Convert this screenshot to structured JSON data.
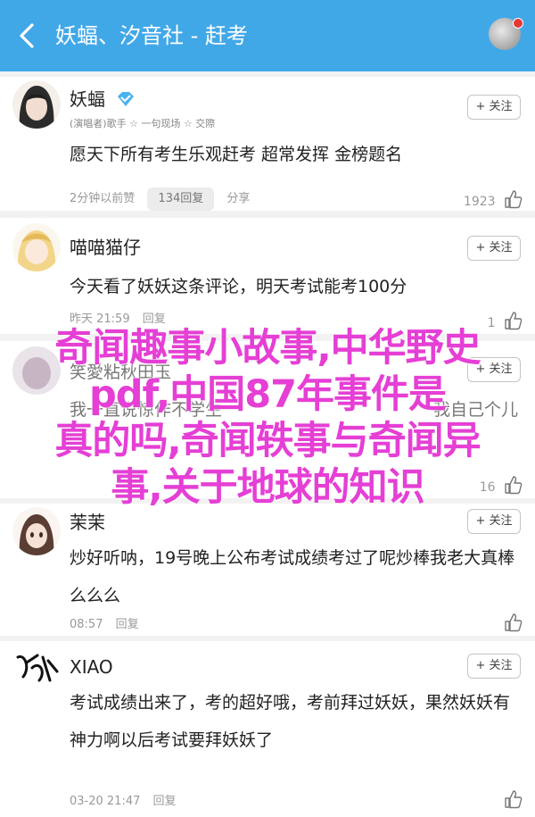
{
  "header": {
    "title": "妖蝠、汐音社 - 赶考",
    "back_icon": "back-arrow-icon",
    "bg_color": "#41a8e8"
  },
  "comments": [
    {
      "name": "妖蝠",
      "badge": "(演唱者)歌手  ☆ 一句现场  ☆ 交際",
      "follow": "+ 关注",
      "text": "愿天下所有考生乐观赶考 超常发挥 金榜题名",
      "time": "2分钟以前赞",
      "reply_count": "134回复",
      "share": "分享",
      "likes": "1923"
    },
    {
      "name": "喵喵猫仔",
      "follow": "+ 关注",
      "text": "今天看了妖妖这条评论，明天考试能考100分",
      "time": "昨天 21:59",
      "reply": "回复",
      "likes": "1"
    },
    {
      "name": "笑愛粘秋田玉",
      "follow": "+ 关注",
      "text_a": "我一直说惊作不学生",
      "text_b": "我自己个儿",
      "likes": "16"
    },
    {
      "name": "茉茉",
      "follow": "+ 关注",
      "text": "炒好听呐，19号晚上公布考试成绩考过了呢炒棒我老大真棒么么么",
      "time": "08:57",
      "reply": "回复"
    },
    {
      "name": "XIAO",
      "follow": "+ 关注",
      "text": "考试成绩出来了，考的超好哦，考前拜过妖妖，果然妖妖有神力啊以后考试要拜妖妖了",
      "time": "03-20 21:47",
      "reply": "回复"
    }
  ],
  "overlay": {
    "lines": [
      "奇闻趣事小故事,中华野史",
      "pdf,中国87年事件是",
      "真的吗,奇闻轶事与奇闻异",
      "事,关于地球的知识"
    ],
    "color": "#e53fd5"
  }
}
